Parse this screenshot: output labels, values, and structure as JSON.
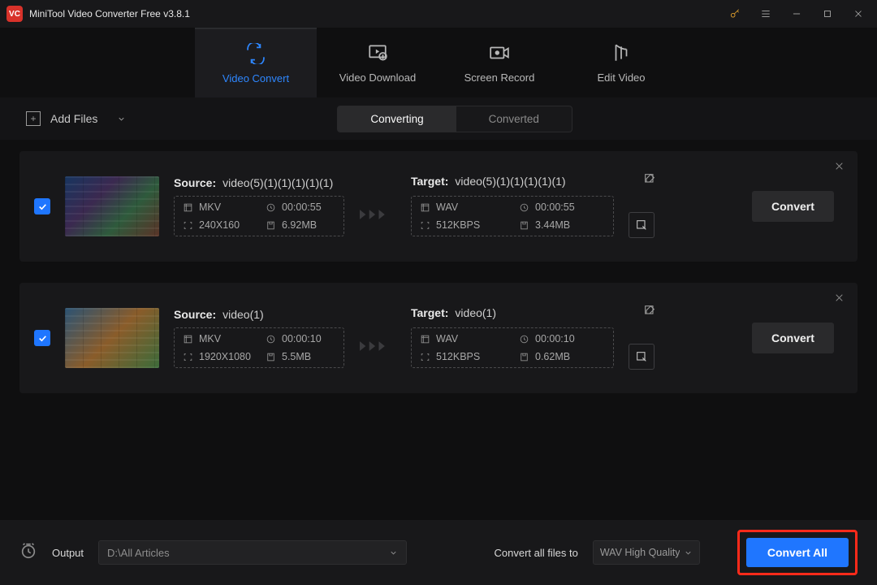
{
  "titlebar": {
    "title": "MiniTool Video Converter Free v3.8.1"
  },
  "main_tabs": [
    {
      "label": "Video Convert",
      "active": true
    },
    {
      "label": "Video Download",
      "active": false
    },
    {
      "label": "Screen Record",
      "active": false
    },
    {
      "label": "Edit Video",
      "active": false
    }
  ],
  "toolbar": {
    "add_files_label": "Add Files",
    "segmented": {
      "converting": "Converting",
      "converted": "Converted",
      "active": "converting"
    }
  },
  "jobs": [
    {
      "checked": true,
      "source": {
        "label": "Source:",
        "filename": "video(5)(1)(1)(1)(1)(1)",
        "format": "MKV",
        "duration": "00:00:55",
        "resolution": "240X160",
        "size": "6.92MB"
      },
      "target": {
        "label": "Target:",
        "filename": "video(5)(1)(1)(1)(1)(1)",
        "format": "WAV",
        "duration": "00:00:55",
        "bitrate": "512KBPS",
        "size": "3.44MB"
      },
      "button": "Convert"
    },
    {
      "checked": true,
      "source": {
        "label": "Source:",
        "filename": "video(1)",
        "format": "MKV",
        "duration": "00:00:10",
        "resolution": "1920X1080",
        "size": "5.5MB"
      },
      "target": {
        "label": "Target:",
        "filename": "video(1)",
        "format": "WAV",
        "duration": "00:00:10",
        "bitrate": "512KBPS",
        "size": "0.62MB"
      },
      "button": "Convert"
    }
  ],
  "footer": {
    "output_label": "Output",
    "output_path": "D:\\All Articles",
    "convert_all_label": "Convert all files to",
    "preset": "WAV High Quality",
    "convert_all_button": "Convert All"
  }
}
